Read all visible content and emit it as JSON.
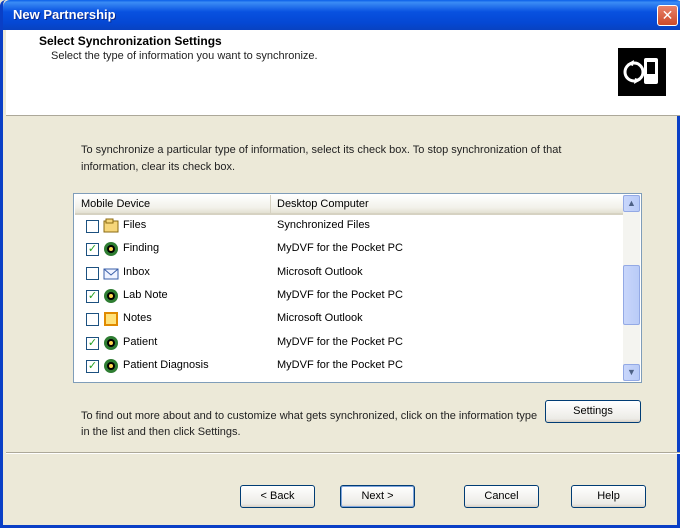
{
  "window": {
    "title": "New Partnership"
  },
  "header": {
    "title": "Select Synchronization Settings",
    "subtitle": "Select the type of information you want to synchronize."
  },
  "instructions": "To synchronize a particular type of information, select its check box. To stop synchronization of that information, clear its check box.",
  "list": {
    "columns": [
      "Mobile Device",
      "Desktop Computer"
    ],
    "rows": [
      {
        "device": "Files",
        "desktop": "Synchronized Files",
        "checked": false,
        "icon": "files-icon"
      },
      {
        "device": "Finding",
        "desktop": "MyDVF for the Pocket PC",
        "checked": true,
        "icon": "sync-provider-icon"
      },
      {
        "device": "Inbox",
        "desktop": "Microsoft Outlook",
        "checked": false,
        "icon": "inbox-icon"
      },
      {
        "device": "Lab Note",
        "desktop": "MyDVF for the Pocket PC",
        "checked": true,
        "icon": "sync-provider-icon"
      },
      {
        "device": "Notes",
        "desktop": "Microsoft Outlook",
        "checked": false,
        "icon": "notes-icon"
      },
      {
        "device": "Patient",
        "desktop": "MyDVF for the Pocket PC",
        "checked": true,
        "icon": "sync-provider-icon"
      },
      {
        "device": "Patient Diagnosis",
        "desktop": "MyDVF for the Pocket PC",
        "checked": true,
        "icon": "sync-provider-icon"
      }
    ]
  },
  "bottom_text": "To find out more about and to customize what gets synchronized, click on the information type in the list and then click Settings.",
  "buttons": {
    "settings": "Settings",
    "back": "< Back",
    "next": "Next >",
    "cancel": "Cancel",
    "help": "Help"
  },
  "icons": {
    "close": "close-icon",
    "logo": "activesync-logo-icon"
  },
  "colors": {
    "titlebar": "#0851E0",
    "dialog_bg": "#ECE9D8",
    "check": "#21A121"
  }
}
